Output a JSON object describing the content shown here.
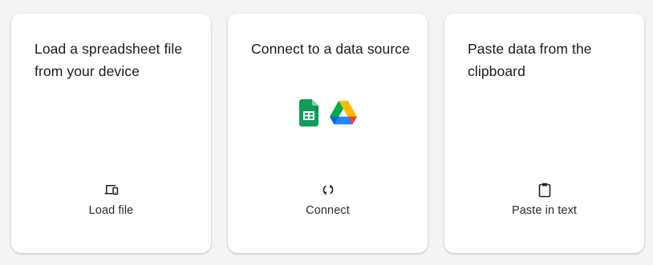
{
  "cards": [
    {
      "title": "Load a spreadsheet file from your device",
      "action_label": "Load file",
      "action_icon": "devices-icon"
    },
    {
      "title": "Connect to a data source",
      "action_label": "Connect",
      "action_icon": "sync-icon",
      "source_icons": [
        "google-sheets-icon",
        "google-drive-icon"
      ]
    },
    {
      "title": "Paste data from the clipboard",
      "action_label": "Paste in text",
      "action_icon": "clipboard-icon"
    }
  ],
  "colors": {
    "background": "#f4f4f5",
    "card": "#ffffff",
    "text": "#1b1b1f",
    "sheets_green": "#0f9d58",
    "drive_yellow": "#ffba00",
    "drive_blue": "#2684fc",
    "drive_green": "#00ac47"
  }
}
